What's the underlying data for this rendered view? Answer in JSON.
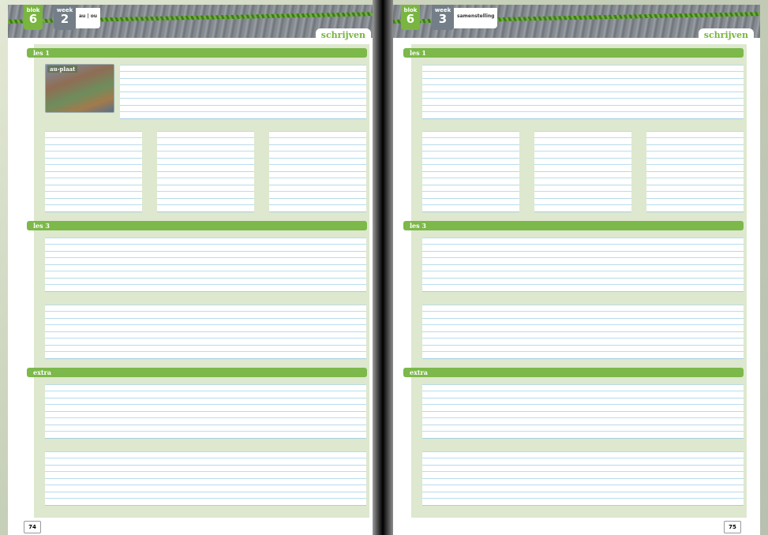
{
  "left_page": {
    "blok_label": "blok",
    "blok_num": "6",
    "week_label": "week",
    "week_num": "2",
    "week_topic": "au | ou",
    "header_tab": "schrijven",
    "sections": {
      "les1": "les 1",
      "les3": "les 3",
      "extra": "extra"
    },
    "image_caption": "au-plaat",
    "page_number": "74"
  },
  "right_page": {
    "blok_label": "blok",
    "blok_num": "6",
    "week_label": "week",
    "week_num": "3",
    "week_topic": "samenstelling",
    "header_tab": "schrijven",
    "sections": {
      "les1": "les 1",
      "les3": "les 3",
      "extra": "extra"
    },
    "page_number": "75"
  },
  "colors": {
    "accent_green": "#7cb84a",
    "section_bg": "#dde8cf",
    "week_gray": "#737e88",
    "line_blue": "#a6d0e2"
  }
}
